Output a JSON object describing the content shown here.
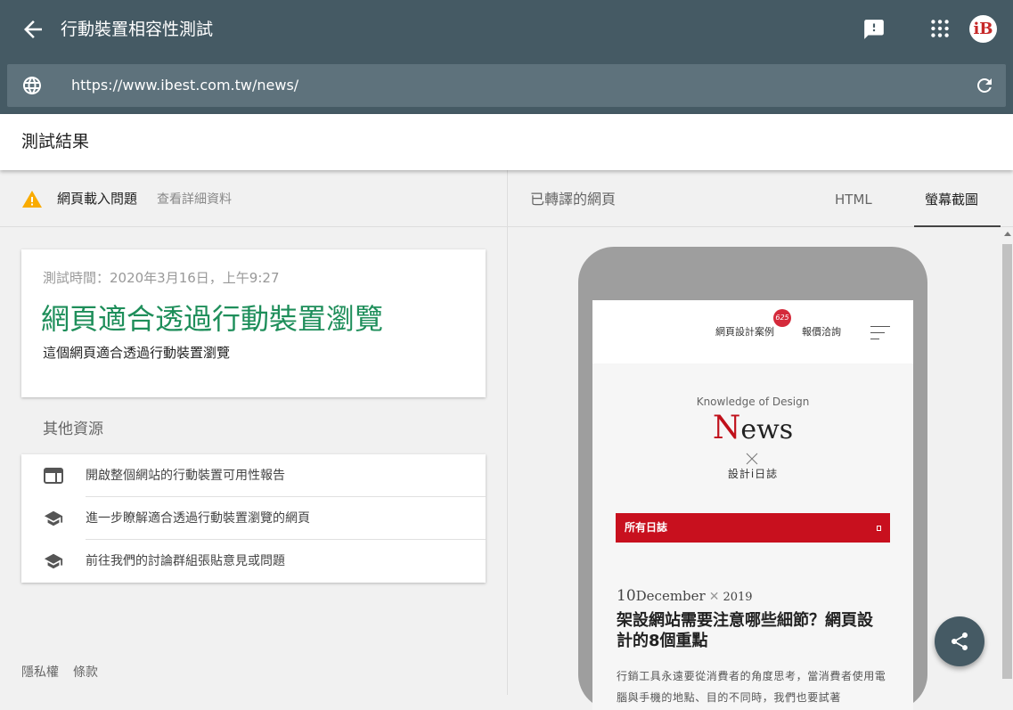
{
  "header": {
    "title": "行動裝置相容性測試",
    "url": "https://www.ibest.com.tw/news/",
    "avatar_letter": "iB"
  },
  "result_bar": {
    "title": "測試結果"
  },
  "issues": {
    "label": "網頁載入問題",
    "details_link": "查看詳細資料"
  },
  "result_card": {
    "time": "測試時間：2020年3月16日，上午9:27",
    "verdict": "網頁適合透過行動裝置瀏覽",
    "subtitle": "這個網頁適合透過行動裝置瀏覽",
    "verdict_color": "#1e8e5a"
  },
  "other_resources": {
    "heading": "其他資源",
    "items": [
      {
        "label": "開啟整個網站的行動裝置可用性報告",
        "icon": "web-report-icon"
      },
      {
        "label": "進一步瞭解適合透過行動裝置瀏覽的網頁",
        "icon": "school-icon"
      },
      {
        "label": "前往我們的討論群組張貼意見或問題",
        "icon": "school-icon"
      }
    ]
  },
  "footer": {
    "privacy": "隱私權",
    "terms": "條款"
  },
  "right_panel": {
    "label": "已轉譯的網頁",
    "tabs": [
      {
        "label": "HTML",
        "active": false
      },
      {
        "label": "螢幕截圖",
        "active": true
      }
    ]
  },
  "preview": {
    "nav_cases": "網頁設計案例",
    "nav_quote": "報價洽詢",
    "badge": "625",
    "kicker": "Knowledge of Design",
    "news_initial": "N",
    "news_rest": "ews",
    "diary": "設計i日誌",
    "all_posts": "所有日誌",
    "date_day": "10",
    "date_month": "December",
    "date_year": "2019",
    "headline": "架設網站需要注意哪些細節？網頁設計的8個重點",
    "body": "行銷工具永遠要從消費者的角度思考，當消費者使用電腦與手機的地點、目的不同時，我們也要試著"
  },
  "colors": {
    "topbar": "#455a64",
    "accent_red": "#c8101e"
  }
}
